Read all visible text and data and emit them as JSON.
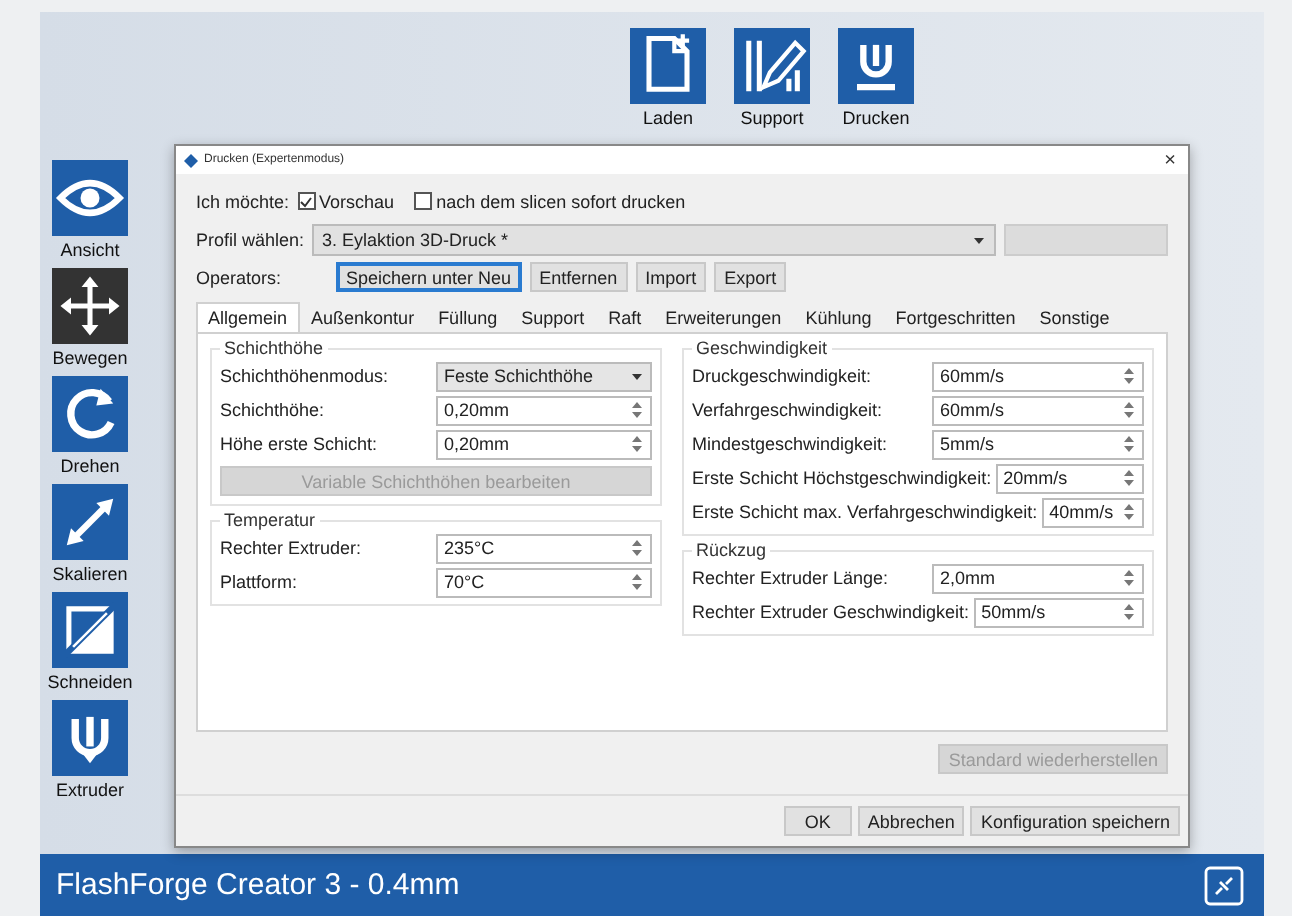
{
  "toolbar_top": [
    {
      "label": "Laden",
      "kind": "file"
    },
    {
      "label": "Support",
      "kind": "support"
    },
    {
      "label": "Drucken",
      "kind": "print"
    }
  ],
  "toolbar_left": [
    {
      "label": "Ansicht",
      "kind": "eye",
      "selected": false
    },
    {
      "label": "Bewegen",
      "kind": "move",
      "selected": true
    },
    {
      "label": "Drehen",
      "kind": "rotate",
      "selected": false
    },
    {
      "label": "Skalieren",
      "kind": "scale",
      "selected": false
    },
    {
      "label": "Schneiden",
      "kind": "cut",
      "selected": false
    },
    {
      "label": "Extruder",
      "kind": "extruder",
      "selected": false
    }
  ],
  "dialog": {
    "title": "Drucken (Expertenmodus)",
    "close": "×",
    "intent": {
      "label": "Ich möchte:",
      "options": [
        {
          "label": "Vorschau",
          "checked": true
        },
        {
          "label": "nach dem slicen sofort drucken",
          "checked": false
        }
      ]
    },
    "profile": {
      "label": "Profil wählen:",
      "value": "3. Eylaktion 3D-Druck *",
      "second_select": {
        "disabled": true
      }
    },
    "operators": {
      "label": "Operators:",
      "buttons": [
        {
          "label": "Speichern unter Neu",
          "focused": true
        },
        {
          "label": "Entfernen",
          "focused": false
        },
        {
          "label": "Import",
          "focused": false
        },
        {
          "label": "Export",
          "focused": false
        }
      ]
    },
    "tabs": [
      {
        "label": "Allgemein",
        "selected": true
      },
      {
        "label": "Außenkontur",
        "selected": false
      },
      {
        "label": "Füllung",
        "selected": false
      },
      {
        "label": "Support",
        "selected": false
      },
      {
        "label": "Raft",
        "selected": false
      },
      {
        "label": "Erweiterungen",
        "selected": false
      },
      {
        "label": "Kühlung",
        "selected": false
      },
      {
        "label": "Fortgeschritten",
        "selected": false
      },
      {
        "label": "Sonstige",
        "selected": false
      }
    ],
    "groups_left": [
      {
        "title": "Schichthöhe",
        "rows": [
          {
            "kind": "combo",
            "label": "Schichthöhenmodus:",
            "value": "Feste Schichthöhe"
          },
          {
            "kind": "spin",
            "label": "Schichthöhe:",
            "value": "0,20mm"
          },
          {
            "kind": "spin",
            "label": "Höhe erste Schicht:",
            "value": "0,20mm"
          },
          {
            "kind": "button",
            "label": "Variable Schichthöhen bearbeiten",
            "disabled": true
          }
        ]
      },
      {
        "title": "Temperatur",
        "rows": [
          {
            "kind": "spin",
            "label": "Rechter Extruder:",
            "value": "235°C"
          },
          {
            "kind": "spin",
            "label": "Plattform:",
            "value": "70°C"
          }
        ]
      }
    ],
    "groups_right": [
      {
        "title": "Geschwindigkeit",
        "rows": [
          {
            "kind": "spin",
            "label": "Druckgeschwindigkeit:",
            "value": "60mm/s"
          },
          {
            "kind": "spin",
            "label": "Verfahrgeschwindigkeit:",
            "value": "60mm/s"
          },
          {
            "kind": "spin",
            "label": "Mindestgeschwindigkeit:",
            "value": "5mm/s"
          },
          {
            "kind": "spin",
            "label": "Erste Schicht Höchstgeschwindigkeit:",
            "value": "20mm/s"
          },
          {
            "kind": "spin",
            "label": "Erste Schicht max. Verfahrgeschwindigkeit:",
            "value": "40mm/s"
          }
        ]
      },
      {
        "title": "Rückzug",
        "rows": [
          {
            "kind": "spin",
            "label": "Rechter Extruder Länge:",
            "value": "2,0mm"
          },
          {
            "kind": "spin",
            "label": "Rechter Extruder Geschwindigkeit:",
            "value": "50mm/s"
          }
        ]
      }
    ],
    "restore_button": {
      "label": "Standard wiederherstellen",
      "disabled": true
    },
    "buttons": [
      "OK",
      "Abbrechen",
      "Konfiguration speichern"
    ]
  },
  "status_bar": {
    "printer": "FlashForge Creator 3 - 0.4mm"
  }
}
